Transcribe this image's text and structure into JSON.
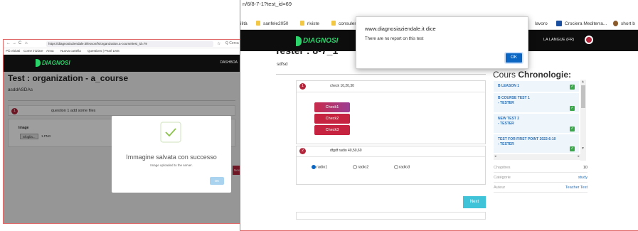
{
  "left_window": {
    "nav": {
      "back": "←",
      "forward": "→",
      "reload": "C",
      "home": "⌂"
    },
    "url": "https://diagnosiaziendale.it/lesson/fs/organization.a-course/test_id=79",
    "search_label": "Q Cerca",
    "bookmarks": [
      "Più visitati",
      "Come iniziare",
      "Anna",
      "Nuova cartella",
      "Questions | Pearl LMS"
    ],
    "logo": "DIAGNOSI",
    "logo_sub": "LMS",
    "nav_right": "DASHBOA",
    "page_title": "Test : organization - a_course",
    "subtitle": "asddASDAs",
    "question_number": "1",
    "question_text": "question 1 add some files",
    "image_label": "Image",
    "file_button": "Sfoglia...",
    "file_name": "1.PNG",
    "side_button": "Nex",
    "dialog": {
      "title": "Immagine salvata con successo",
      "message": "Image uploaded to the server.",
      "ok": "OK"
    }
  },
  "right_window": {
    "url": "n/6/8-7-1?test_id=69",
    "bookmarks": [
      {
        "label": "ilità"
      },
      {
        "label": "sanfele2050",
        "icon": "folder-icon"
      },
      {
        "label": "riviste",
        "icon": "folder-icon"
      },
      {
        "label": "consulenz",
        "icon": "folder-icon"
      }
    ],
    "bookmarks_right": [
      {
        "label": "lavoro"
      },
      {
        "label": "Crociera Mediterra...",
        "icon": "ship-icon"
      },
      {
        "label": "short b",
        "icon": "owl-icon"
      }
    ],
    "logo": "DIAGNOSI",
    "logo_sub": "LMS",
    "language": "LA LANGUE (FR)",
    "page_title": "Tester : 8-7_1",
    "subtitle": "sdfsd",
    "questions": [
      {
        "number": "1",
        "text": "check 10,20,30",
        "options": [
          "Check1",
          "Check2",
          "Check3"
        ]
      },
      {
        "number": "2",
        "text": "dfgdf radio 40,50,60",
        "options": [
          "radio1",
          "radio2",
          "radio3"
        ],
        "selected": 0
      }
    ],
    "next_button": "Next",
    "chronology": {
      "title_prefix": "Cours",
      "title_strong": "Chronologie:",
      "items": [
        {
          "label": "B LEASON 1",
          "done": true
        },
        {
          "label": "B COURSE TEST 1\n- TESTER",
          "done": true
        },
        {
          "label": "NEW TEST 2\n- TESTER",
          "done": true
        },
        {
          "label": "TEST FOR FIRST POINT 2022-6-10\n- TESTER",
          "done": true
        }
      ]
    },
    "meta": [
      {
        "key": "Chapitres",
        "value": "10"
      },
      {
        "key": "Catégorie",
        "value": "study"
      },
      {
        "key": "Auteur",
        "value": "Teacher Test"
      }
    ],
    "alert": {
      "origin": "www.diagnosiaziendale.it dice",
      "message": "There are no report on this test",
      "ok": "OK"
    }
  },
  "colors": {
    "logo_green": "#2bd46b",
    "accent_red": "#b2253a",
    "next_teal": "#3ec3d9",
    "link_blue": "#2a6fb5",
    "check_green": "#3aa84a",
    "alert_blue": "#0b66c3"
  }
}
